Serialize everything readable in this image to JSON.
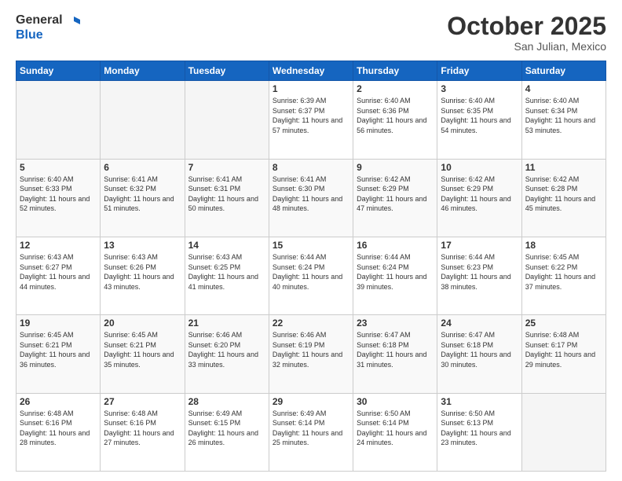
{
  "header": {
    "logo_general": "General",
    "logo_blue": "Blue",
    "month": "October 2025",
    "location": "San Julian, Mexico"
  },
  "days_of_week": [
    "Sunday",
    "Monday",
    "Tuesday",
    "Wednesday",
    "Thursday",
    "Friday",
    "Saturday"
  ],
  "weeks": [
    [
      {
        "day": "",
        "info": ""
      },
      {
        "day": "",
        "info": ""
      },
      {
        "day": "",
        "info": ""
      },
      {
        "day": "1",
        "info": "Sunrise: 6:39 AM\nSunset: 6:37 PM\nDaylight: 11 hours and 57 minutes."
      },
      {
        "day": "2",
        "info": "Sunrise: 6:40 AM\nSunset: 6:36 PM\nDaylight: 11 hours and 56 minutes."
      },
      {
        "day": "3",
        "info": "Sunrise: 6:40 AM\nSunset: 6:35 PM\nDaylight: 11 hours and 54 minutes."
      },
      {
        "day": "4",
        "info": "Sunrise: 6:40 AM\nSunset: 6:34 PM\nDaylight: 11 hours and 53 minutes."
      }
    ],
    [
      {
        "day": "5",
        "info": "Sunrise: 6:40 AM\nSunset: 6:33 PM\nDaylight: 11 hours and 52 minutes."
      },
      {
        "day": "6",
        "info": "Sunrise: 6:41 AM\nSunset: 6:32 PM\nDaylight: 11 hours and 51 minutes."
      },
      {
        "day": "7",
        "info": "Sunrise: 6:41 AM\nSunset: 6:31 PM\nDaylight: 11 hours and 50 minutes."
      },
      {
        "day": "8",
        "info": "Sunrise: 6:41 AM\nSunset: 6:30 PM\nDaylight: 11 hours and 48 minutes."
      },
      {
        "day": "9",
        "info": "Sunrise: 6:42 AM\nSunset: 6:29 PM\nDaylight: 11 hours and 47 minutes."
      },
      {
        "day": "10",
        "info": "Sunrise: 6:42 AM\nSunset: 6:29 PM\nDaylight: 11 hours and 46 minutes."
      },
      {
        "day": "11",
        "info": "Sunrise: 6:42 AM\nSunset: 6:28 PM\nDaylight: 11 hours and 45 minutes."
      }
    ],
    [
      {
        "day": "12",
        "info": "Sunrise: 6:43 AM\nSunset: 6:27 PM\nDaylight: 11 hours and 44 minutes."
      },
      {
        "day": "13",
        "info": "Sunrise: 6:43 AM\nSunset: 6:26 PM\nDaylight: 11 hours and 43 minutes."
      },
      {
        "day": "14",
        "info": "Sunrise: 6:43 AM\nSunset: 6:25 PM\nDaylight: 11 hours and 41 minutes."
      },
      {
        "day": "15",
        "info": "Sunrise: 6:44 AM\nSunset: 6:24 PM\nDaylight: 11 hours and 40 minutes."
      },
      {
        "day": "16",
        "info": "Sunrise: 6:44 AM\nSunset: 6:24 PM\nDaylight: 11 hours and 39 minutes."
      },
      {
        "day": "17",
        "info": "Sunrise: 6:44 AM\nSunset: 6:23 PM\nDaylight: 11 hours and 38 minutes."
      },
      {
        "day": "18",
        "info": "Sunrise: 6:45 AM\nSunset: 6:22 PM\nDaylight: 11 hours and 37 minutes."
      }
    ],
    [
      {
        "day": "19",
        "info": "Sunrise: 6:45 AM\nSunset: 6:21 PM\nDaylight: 11 hours and 36 minutes."
      },
      {
        "day": "20",
        "info": "Sunrise: 6:45 AM\nSunset: 6:21 PM\nDaylight: 11 hours and 35 minutes."
      },
      {
        "day": "21",
        "info": "Sunrise: 6:46 AM\nSunset: 6:20 PM\nDaylight: 11 hours and 33 minutes."
      },
      {
        "day": "22",
        "info": "Sunrise: 6:46 AM\nSunset: 6:19 PM\nDaylight: 11 hours and 32 minutes."
      },
      {
        "day": "23",
        "info": "Sunrise: 6:47 AM\nSunset: 6:18 PM\nDaylight: 11 hours and 31 minutes."
      },
      {
        "day": "24",
        "info": "Sunrise: 6:47 AM\nSunset: 6:18 PM\nDaylight: 11 hours and 30 minutes."
      },
      {
        "day": "25",
        "info": "Sunrise: 6:48 AM\nSunset: 6:17 PM\nDaylight: 11 hours and 29 minutes."
      }
    ],
    [
      {
        "day": "26",
        "info": "Sunrise: 6:48 AM\nSunset: 6:16 PM\nDaylight: 11 hours and 28 minutes."
      },
      {
        "day": "27",
        "info": "Sunrise: 6:48 AM\nSunset: 6:16 PM\nDaylight: 11 hours and 27 minutes."
      },
      {
        "day": "28",
        "info": "Sunrise: 6:49 AM\nSunset: 6:15 PM\nDaylight: 11 hours and 26 minutes."
      },
      {
        "day": "29",
        "info": "Sunrise: 6:49 AM\nSunset: 6:14 PM\nDaylight: 11 hours and 25 minutes."
      },
      {
        "day": "30",
        "info": "Sunrise: 6:50 AM\nSunset: 6:14 PM\nDaylight: 11 hours and 24 minutes."
      },
      {
        "day": "31",
        "info": "Sunrise: 6:50 AM\nSunset: 6:13 PM\nDaylight: 11 hours and 23 minutes."
      },
      {
        "day": "",
        "info": ""
      }
    ]
  ]
}
